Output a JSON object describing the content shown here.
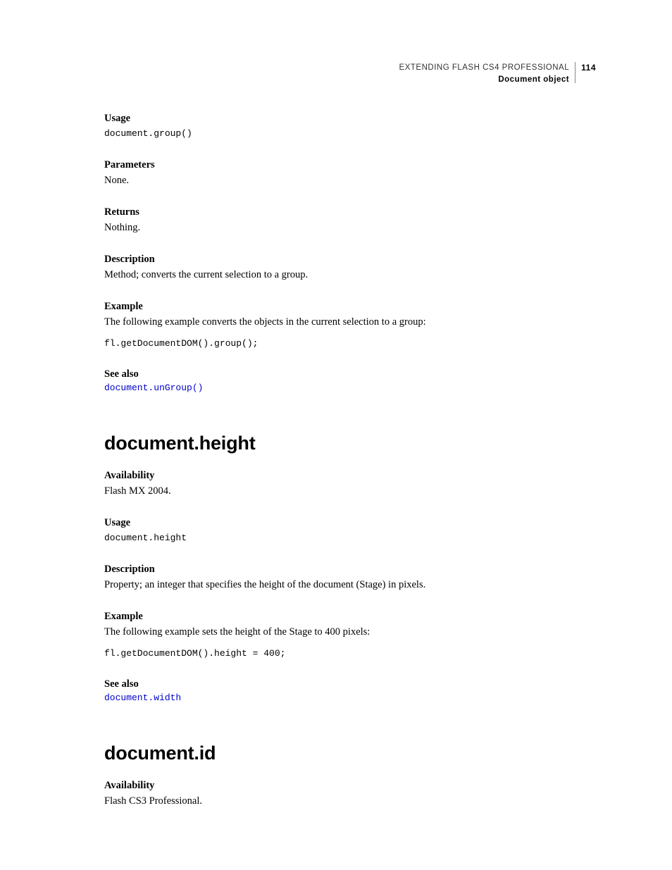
{
  "header": {
    "title": "EXTENDING FLASH CS4 PROFESSIONAL",
    "subtitle": "Document object",
    "page_number": "114"
  },
  "sec1": {
    "usage_label": "Usage",
    "usage_code": "document.group()",
    "parameters_label": "Parameters",
    "parameters_text": "None.",
    "returns_label": "Returns",
    "returns_text": "Nothing.",
    "description_label": "Description",
    "description_text": "Method; converts the current selection to a group.",
    "example_label": "Example",
    "example_text": "The following example converts the objects in the current selection to a group:",
    "example_code": "fl.getDocumentDOM().group();",
    "seealso_label": "See also",
    "seealso_link": "document.unGroup()"
  },
  "sec2": {
    "heading": "document.height",
    "availability_label": "Availability",
    "availability_text": "Flash MX 2004.",
    "usage_label": "Usage",
    "usage_code": "document.height",
    "description_label": "Description",
    "description_text": "Property; an integer that specifies the height of the document (Stage) in pixels.",
    "example_label": "Example",
    "example_text": "The following example sets the height of the Stage to 400 pixels:",
    "example_code": "fl.getDocumentDOM().height = 400;",
    "seealso_label": "See also",
    "seealso_link": "document.width"
  },
  "sec3": {
    "heading": "document.id",
    "availability_label": "Availability",
    "availability_text": "Flash CS3 Professional."
  }
}
